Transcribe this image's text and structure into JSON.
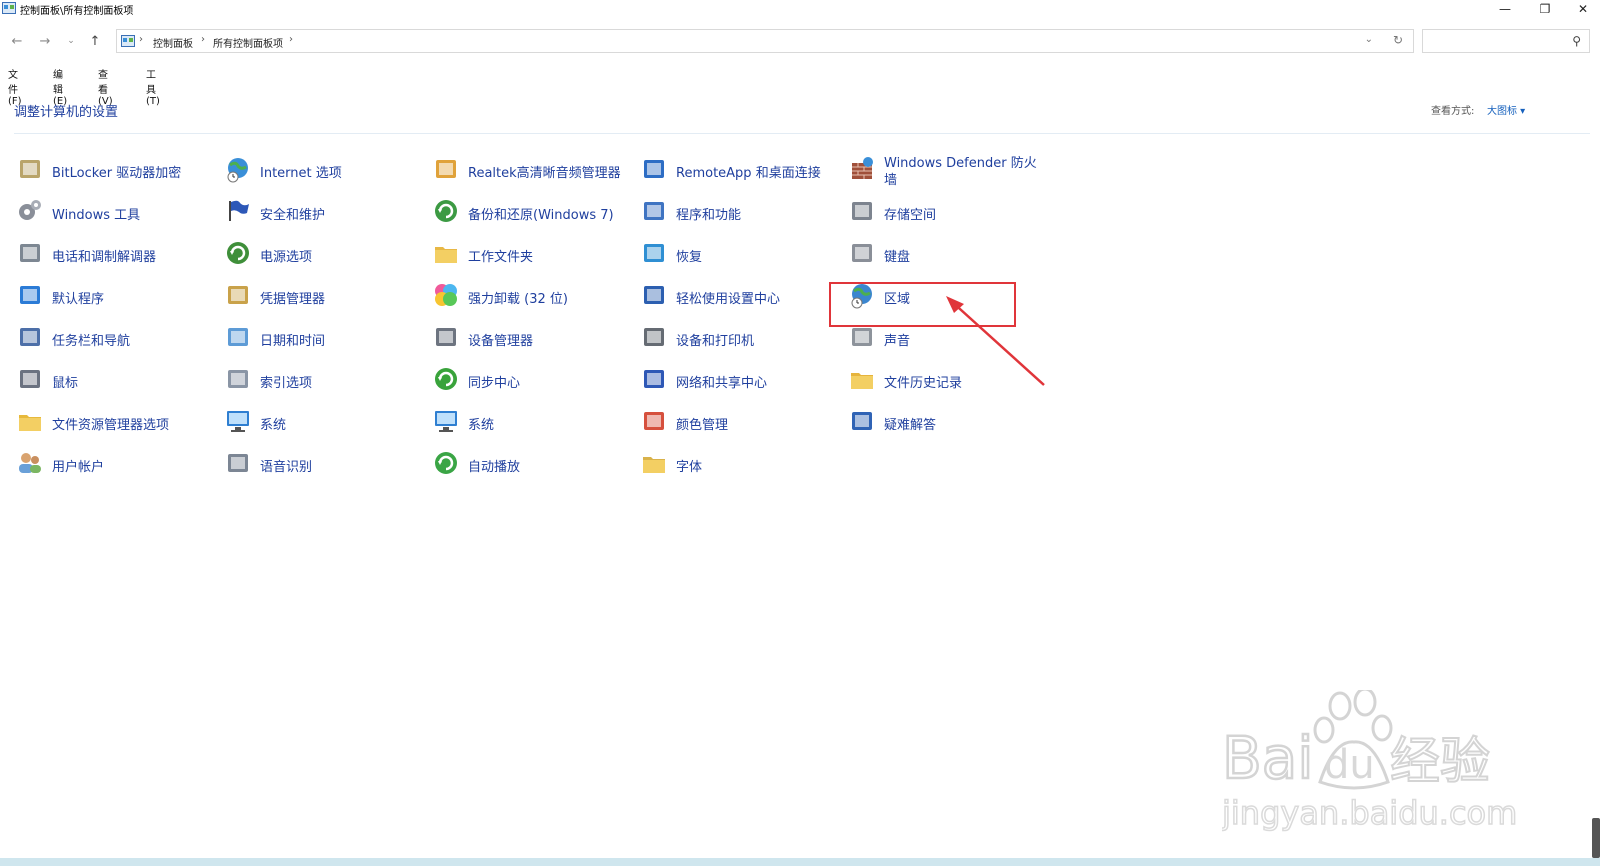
{
  "window": {
    "title": "控制面板\\所有控制面板项",
    "controls": {
      "minimize": "—",
      "restore": "❐",
      "close": "✕"
    }
  },
  "address": {
    "crumbs": [
      "控制面板",
      "所有控制面板项"
    ],
    "separator": "›",
    "search_placeholder": ""
  },
  "menu": [
    "文件(F)",
    "编辑(E)",
    "查看(V)",
    "工具(T)"
  ],
  "header": {
    "title": "调整计算机的设置",
    "view_by_label": "查看方式:",
    "view_by_value": "大图标 ▾"
  },
  "items": [
    {
      "label": "BitLocker 驱动器加密",
      "icon": "bitlocker-icon",
      "color": "#b9a46a"
    },
    {
      "label": "Windows 工具",
      "icon": "gears-icon",
      "color": "#8a8f99"
    },
    {
      "label": "电话和调制解调器",
      "icon": "phone-icon",
      "color": "#7d8792"
    },
    {
      "label": "默认程序",
      "icon": "default-programs-icon",
      "color": "#2b7bd6"
    },
    {
      "label": "任务栏和导航",
      "icon": "taskbar-icon",
      "color": "#4d6fa8"
    },
    {
      "label": "鼠标",
      "icon": "mouse-icon",
      "color": "#6b7280"
    },
    {
      "label": "文件资源管理器选项",
      "icon": "folder-options-icon",
      "color": "#e7b93c"
    },
    {
      "label": "用户帐户",
      "icon": "users-icon",
      "color": "#6aa0d8"
    },
    {
      "label": "Internet 选项",
      "icon": "internet-icon",
      "color": "#3a8fd8"
    },
    {
      "label": "安全和维护",
      "icon": "flag-icon",
      "color": "#2d58b8"
    },
    {
      "label": "电源选项",
      "icon": "power-icon",
      "color": "#3f8f3a"
    },
    {
      "label": "凭据管理器",
      "icon": "credential-icon",
      "color": "#c9a24a"
    },
    {
      "label": "日期和时间",
      "icon": "clock-icon",
      "color": "#5d9bd6"
    },
    {
      "label": "索引选项",
      "icon": "index-icon",
      "color": "#8a95a5"
    },
    {
      "label": "系统",
      "icon": "system-icon",
      "color": "#2f7fd1"
    },
    {
      "label": "语音识别",
      "icon": "microphone-icon",
      "color": "#7c8694"
    },
    {
      "label": "Realtek高清晰音频管理器",
      "icon": "realtek-icon",
      "color": "#e0a23a"
    },
    {
      "label": "备份和还原(Windows 7)",
      "icon": "backup-icon",
      "color": "#3c9a43"
    },
    {
      "label": "工作文件夹",
      "icon": "work-folder-icon",
      "color": "#e8b845"
    },
    {
      "label": "强力卸载 (32 位)",
      "icon": "uninstall-icon",
      "color": "#e64a86"
    },
    {
      "label": "设备管理器",
      "icon": "device-manager-icon",
      "color": "#6d7480"
    },
    {
      "label": "同步中心",
      "icon": "sync-icon",
      "color": "#39a33b"
    },
    {
      "label": "系统",
      "icon": "system-icon",
      "color": "#2f7fd1"
    },
    {
      "label": "自动播放",
      "icon": "autoplay-icon",
      "color": "#3aa545"
    },
    {
      "label": "RemoteApp 和桌面连接",
      "icon": "remoteapp-icon",
      "color": "#2d6dc4"
    },
    {
      "label": "程序和功能",
      "icon": "programs-icon",
      "color": "#3f74c2"
    },
    {
      "label": "恢复",
      "icon": "recovery-icon",
      "color": "#2f8fd3"
    },
    {
      "label": "轻松使用设置中心",
      "icon": "ease-of-access-icon",
      "color": "#2c5fb0"
    },
    {
      "label": "设备和打印机",
      "icon": "printer-icon",
      "color": "#656b73"
    },
    {
      "label": "网络和共享中心",
      "icon": "network-icon",
      "color": "#2e58b6"
    },
    {
      "label": "颜色管理",
      "icon": "color-management-icon",
      "color": "#d6503d"
    },
    {
      "label": "字体",
      "icon": "font-icon",
      "color": "#d9b24a"
    },
    {
      "label": "Windows Defender 防火墙",
      "icon": "firewall-icon",
      "color": "#a0503a"
    },
    {
      "label": "存储空间",
      "icon": "storage-icon",
      "color": "#7d848f"
    },
    {
      "label": "键盘",
      "icon": "keyboard-icon",
      "color": "#8a8f98"
    },
    {
      "label": "区域",
      "icon": "region-globe-icon",
      "color": "#3b86cf"
    },
    {
      "label": "声音",
      "icon": "speaker-icon",
      "color": "#8d939b"
    },
    {
      "label": "文件历史记录",
      "icon": "file-history-icon",
      "color": "#e6b43d"
    },
    {
      "label": "疑难解答",
      "icon": "troubleshoot-icon",
      "color": "#2f63b5"
    }
  ],
  "annotation": {
    "highlight_color": "#e0353a"
  },
  "watermark": {
    "brand": "Bai",
    "brand_paw": "du",
    "brand_cn": "经验",
    "url": "jingyan.baidu.com"
  }
}
